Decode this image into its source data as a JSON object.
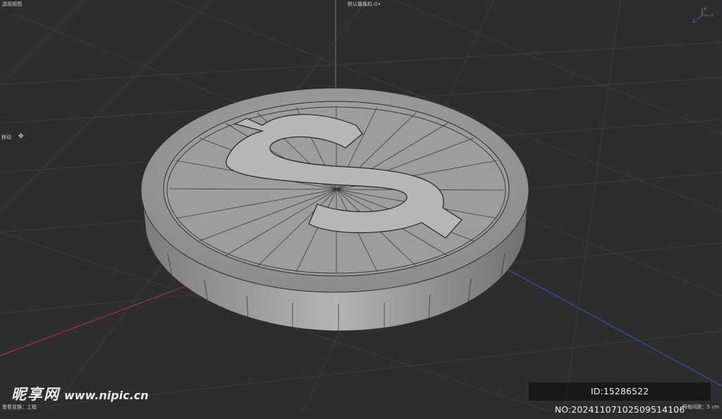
{
  "viewport": {
    "view_name": "透视视图",
    "camera": "默认摄像机·⊡•",
    "tool": "移动",
    "tool_icon": "move-icon",
    "status_left": "查看变换：工程",
    "status_right": "网格间距：5 cm",
    "colors": {
      "background": "#2d2d2d",
      "grid": "#3a3a3a",
      "axis_x": "#b23a3a",
      "axis_y": "#2f9a4c",
      "axis_z": "#2f5fb8",
      "model_face": "#9a9a9a",
      "model_edge": "#2a2a2a"
    }
  },
  "model": {
    "name": "coin",
    "symbol": "$"
  },
  "watermark": {
    "brand": "昵享网",
    "site": "www.nipic.cn",
    "id_text": "ID:15286522 NO:20241107102509514106"
  }
}
